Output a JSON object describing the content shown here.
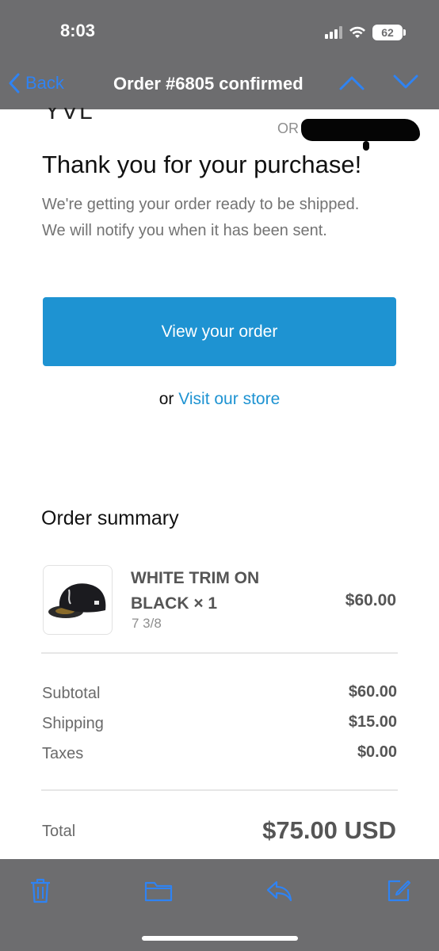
{
  "status_bar": {
    "time": "8:03",
    "battery": "62"
  },
  "nav": {
    "back_label": "Back",
    "title": "Order #6805 confirmed"
  },
  "email": {
    "brand_partial": "YVL",
    "order_partial": "OR",
    "heading": "Thank you for your purchase!",
    "message": "We're getting your order ready to be shipped. We will notify you when it has been sent.",
    "view_order_button": "View your order",
    "store_prefix": "or ",
    "store_link": "Visit our store"
  },
  "summary": {
    "title": "Order summary",
    "item": {
      "name_line1": "WHITE TRIM ON",
      "name_line2": "BLACK × 1",
      "variant": "7 3/8",
      "price": "$60.00"
    },
    "rows": [
      {
        "label": "Subtotal",
        "value": "$60.00"
      },
      {
        "label": "Shipping",
        "value": "$15.00"
      },
      {
        "label": "Taxes",
        "value": "$0.00"
      }
    ],
    "total_label": "Total",
    "total_value": "$75.00 USD"
  },
  "toolbar": {
    "icons": [
      "trash-icon",
      "folder-icon",
      "reply-icon",
      "compose-icon"
    ]
  },
  "colors": {
    "accent": "#1e93d2",
    "ios_blue": "#2f83f3",
    "chrome_gray": "#6d6d6f"
  }
}
